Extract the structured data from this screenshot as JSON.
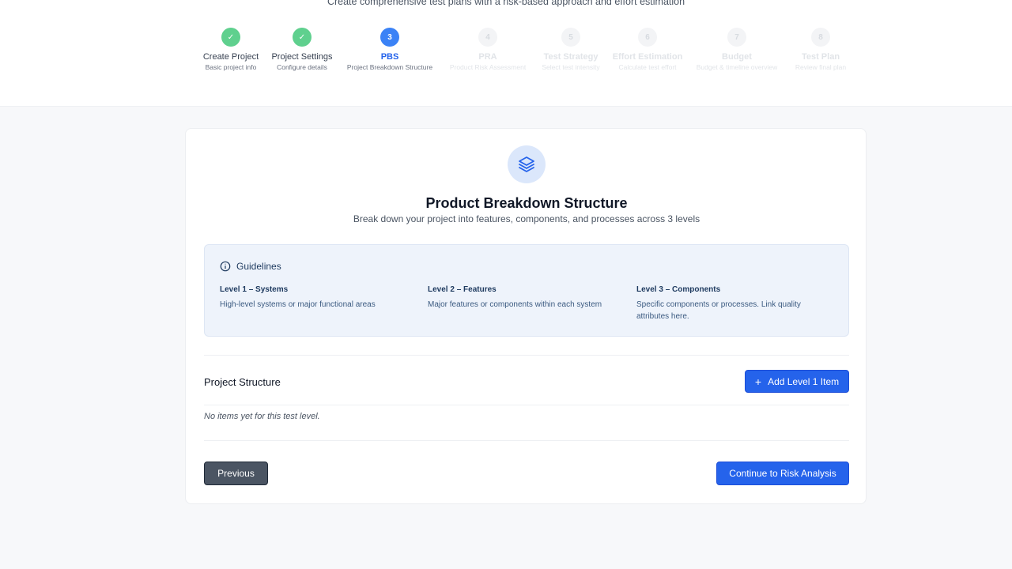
{
  "header": {
    "subtitle": "Create comprehensive test plans with a risk-based approach and effort estimation"
  },
  "steps": [
    {
      "number": "✓",
      "label": "Create Project",
      "desc": "Basic project info",
      "state": "done"
    },
    {
      "number": "✓",
      "label": "Project Settings",
      "desc": "Configure details",
      "state": "done"
    },
    {
      "number": "3",
      "label": "PBS",
      "desc": "Project Breakdown Structure",
      "state": "current"
    },
    {
      "number": "4",
      "label": "PRA",
      "desc": "Product Risk Assessment",
      "state": "pending"
    },
    {
      "number": "5",
      "label": "Test Strategy",
      "desc": "Select test intensity",
      "state": "pending"
    },
    {
      "number": "6",
      "label": "Effort Estimation",
      "desc": "Calculate test effort",
      "state": "pending"
    },
    {
      "number": "7",
      "label": "Budget",
      "desc": "Budget & timeline overview",
      "state": "pending"
    },
    {
      "number": "8",
      "label": "Test Plan",
      "desc": "Review final plan",
      "state": "pending"
    }
  ],
  "card": {
    "icon": "layers-icon",
    "title": "Product Breakdown Structure",
    "subtitle": "Break down your project into features, components, and processes across 3 levels"
  },
  "guidelines": {
    "heading": "Guidelines",
    "icon": "info-icon",
    "levels": [
      {
        "title": "Level 1 – Systems",
        "desc": "High-level systems or major functional areas"
      },
      {
        "title": "Level 2 – Features",
        "desc": "Major features or components within each system"
      },
      {
        "title": "Level 3 – Components",
        "desc": "Specific components or processes. Link quality attributes here."
      }
    ]
  },
  "structure": {
    "title": "Project Structure",
    "add_button": "Add Level 1 Item",
    "empty_text": "No items yet for this test level."
  },
  "nav": {
    "previous": "Previous",
    "continue": "Continue to Risk Analysis"
  },
  "colors": {
    "primary": "#2563eb",
    "done": "#5fd08e",
    "secondary_button": "#4b5563"
  }
}
